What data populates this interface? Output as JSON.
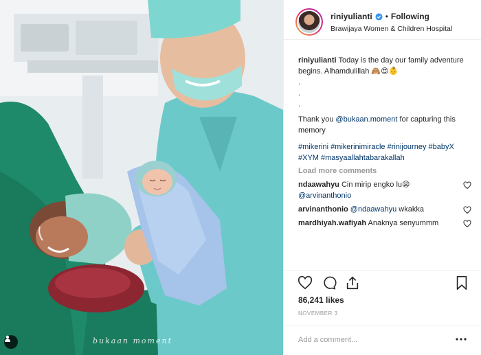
{
  "post": {
    "photo_alt": "Parents with newborn in delivery room",
    "watermark": "bukaan moment"
  },
  "header": {
    "username": "riniyulianti",
    "dot": "•",
    "follow_status": "Following",
    "location": "Brawijaya Women & Children Hospital",
    "avatar_icon": "profile-avatar",
    "verified_icon": "verified-badge"
  },
  "caption": {
    "username": "riniyulianti",
    "line1": "Today is the day our family adventure begins. Alhamdulillah 🙈😍👶",
    "dots": [
      ".",
      ".",
      "."
    ],
    "thanks_prefix": "Thank you ",
    "mention": "@bukaan.moment",
    "thanks_suffix": " for capturing this memory",
    "hashtags": "#mikerini #mikerinimiracle #rinijourney #babyX #XYM #masyaallahtabarakallah"
  },
  "load_more": "Load more comments",
  "comments": [
    {
      "username": "ndaawahyu",
      "text": "Cin mirip engko lu😩",
      "mention": "@arvinanthonio"
    },
    {
      "username": "arvinanthonio",
      "mention": "@ndaawahyu",
      "text": " wkakka"
    },
    {
      "username": "mardhiyah.wafiyah",
      "text": "Anaknya senyummm"
    }
  ],
  "actions": {
    "icons": [
      "heart-icon",
      "comment-icon",
      "share-icon",
      "bookmark-icon"
    ]
  },
  "likes": "86,241 likes",
  "date": "NOVEMBER 3",
  "add_comment": {
    "placeholder": "Add a comment...",
    "more_icon": "ellipsis-icon"
  },
  "colors": {
    "link": "#003569",
    "muted": "#999999",
    "text": "#262626",
    "scrubs": "#6cc9c9",
    "drape": "#1f8a6a"
  }
}
